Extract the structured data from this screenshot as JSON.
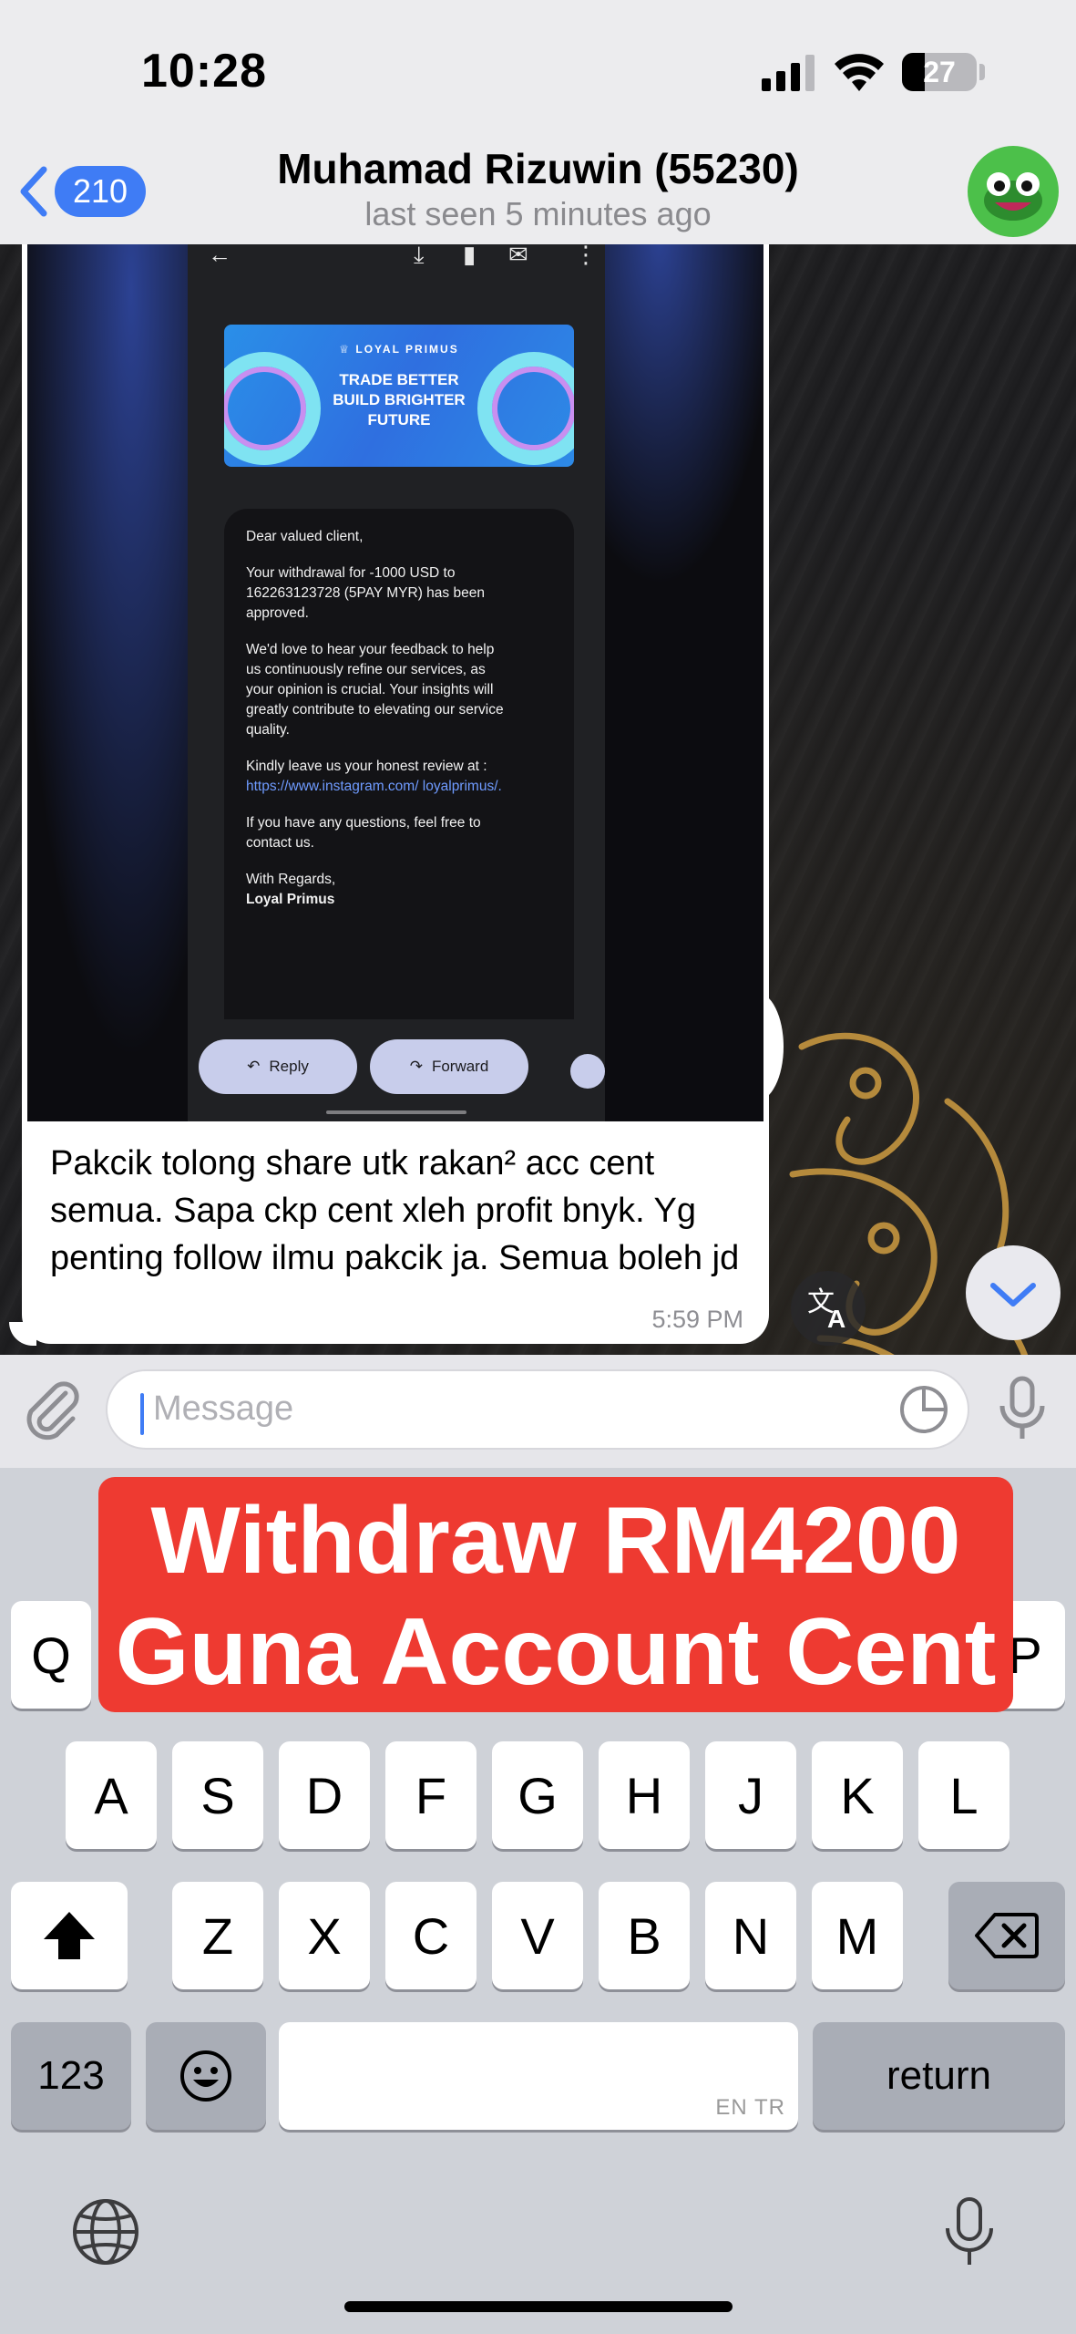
{
  "status_bar": {
    "time": "10:28",
    "battery": "27"
  },
  "header": {
    "back_count": "210",
    "title": "Muhamad Rizuwin (55230)",
    "subtitle": "last seen 5 minutes ago"
  },
  "message": {
    "text": "Pakcik tolong share utk rakan² acc cent semua. Sapa ckp cent xleh profit bnyk. Yg penting follow ilmu pakcik ja. Semua boleh jd",
    "time": "5:59 PM",
    "image": {
      "banner_brand": "♕ LOYAL PRIMUS",
      "banner_line1": "TRADE BETTER",
      "banner_line2": "BUILD BRIGHTER",
      "banner_line3": "FUTURE",
      "greeting": "Dear valued client,",
      "para1": "Your withdrawal for -1000 USD to 162263123728 (5PAY MYR) has been approved.",
      "para2": "We'd love to hear your feedback to help us continuously refine our services, as your opinion is crucial. Your insights will greatly contribute to elevating our service quality.",
      "para3": "Kindly leave us your honest review at :",
      "link": "https://www.instagram.com/ loyalprimus/.",
      "para4": "If you have any questions, feel free to contact us.",
      "signoff": "With Regards,",
      "signature": "Loyal Primus",
      "reply_label": "Reply",
      "forward_label": "Forward"
    }
  },
  "input": {
    "placeholder": "Message"
  },
  "overlay": {
    "line1": "Withdraw RM4200",
    "line2": "Guna Account Cent"
  },
  "keyboard": {
    "row1_visible": [
      "Q",
      "P"
    ],
    "row2": [
      "A",
      "S",
      "D",
      "F",
      "G",
      "H",
      "J",
      "K",
      "L"
    ],
    "row3": [
      "Z",
      "X",
      "C",
      "V",
      "B",
      "N",
      "M"
    ],
    "numbers_label": "123",
    "space_hint": "EN TR",
    "return_label": "return"
  },
  "colors": {
    "accent": "#3f7cf5",
    "overlay_red": "#ee3a31",
    "link": "#6f9bff"
  }
}
